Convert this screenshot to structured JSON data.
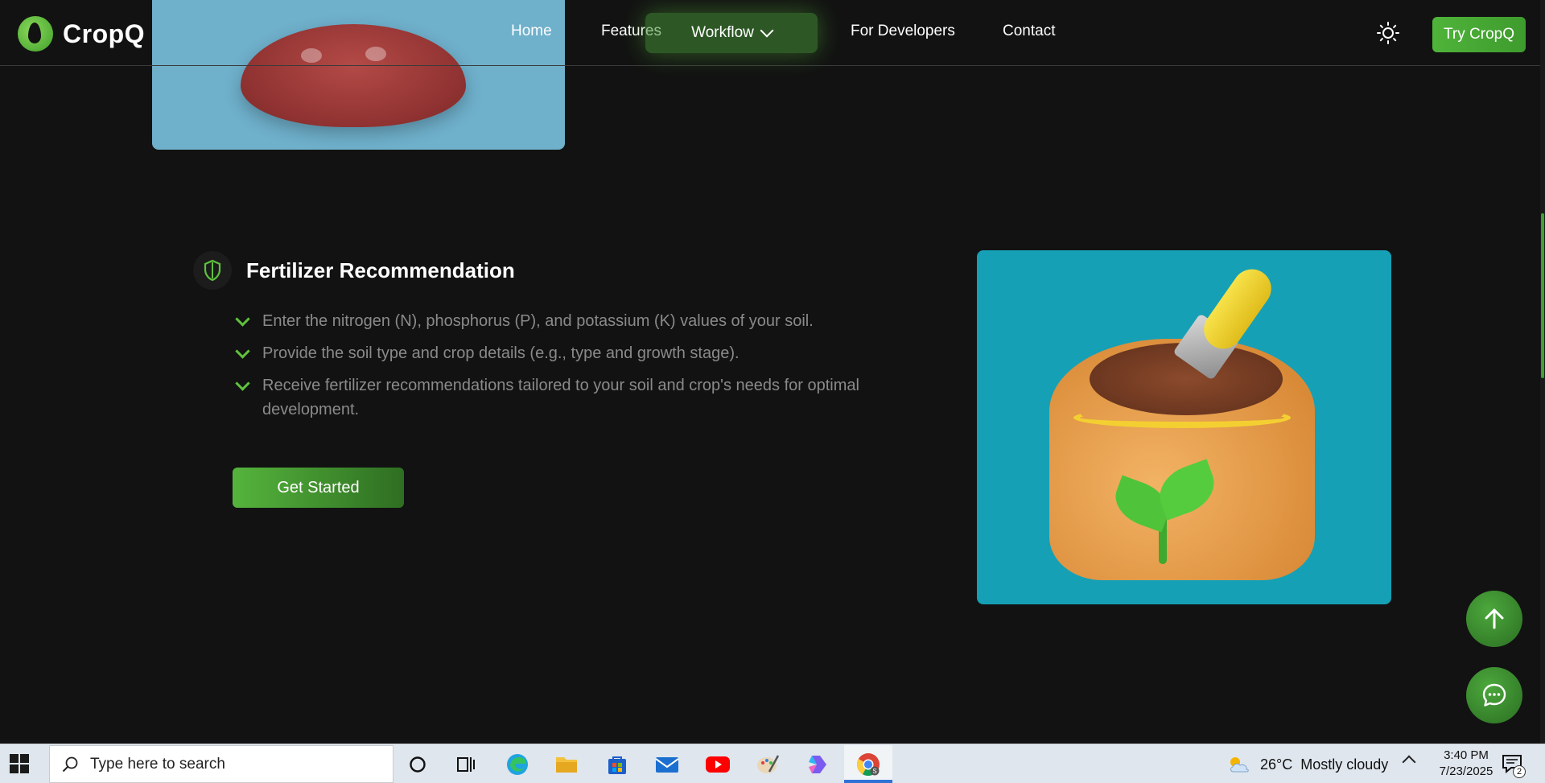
{
  "brand": {
    "name": "CropQ",
    "accent": "#5fc23d"
  },
  "nav": {
    "items": [
      {
        "label": "Home"
      },
      {
        "label": "Features"
      },
      {
        "label": "Workflow"
      },
      {
        "label": "For Developers"
      },
      {
        "label": "Contact"
      }
    ],
    "cta_label": "Try CropQ",
    "theme_icon": "sun-icon"
  },
  "section": {
    "title": "Fertilizer Recommendation",
    "title_icon": "shield-icon",
    "bullets": [
      "Enter the nitrogen (N), phosphorus (P), and potassium (K) values of your soil.",
      "Provide the soil type and crop details (e.g., type and growth stage).",
      "Receive fertilizer recommendations tailored to your soil and crop's needs for optimal development."
    ],
    "button_label": "Get Started",
    "image_alt": "fertilizer-bag-illustration"
  },
  "floating": {
    "scroll_top_icon": "arrow-up-icon",
    "chat_icon": "chat-icon"
  },
  "taskbar": {
    "search_placeholder": "Type here to search",
    "weather_temp": "26°C",
    "weather_desc": "Mostly cloudy",
    "time": "3:40 PM",
    "date": "7/23/2025",
    "notification_count": "2",
    "apps": [
      "cortana-icon",
      "task-view-icon",
      "edge-icon",
      "file-explorer-icon",
      "store-icon",
      "mail-icon",
      "youtube-icon",
      "paint-icon",
      "copilot-icon",
      "chrome-icon"
    ]
  }
}
